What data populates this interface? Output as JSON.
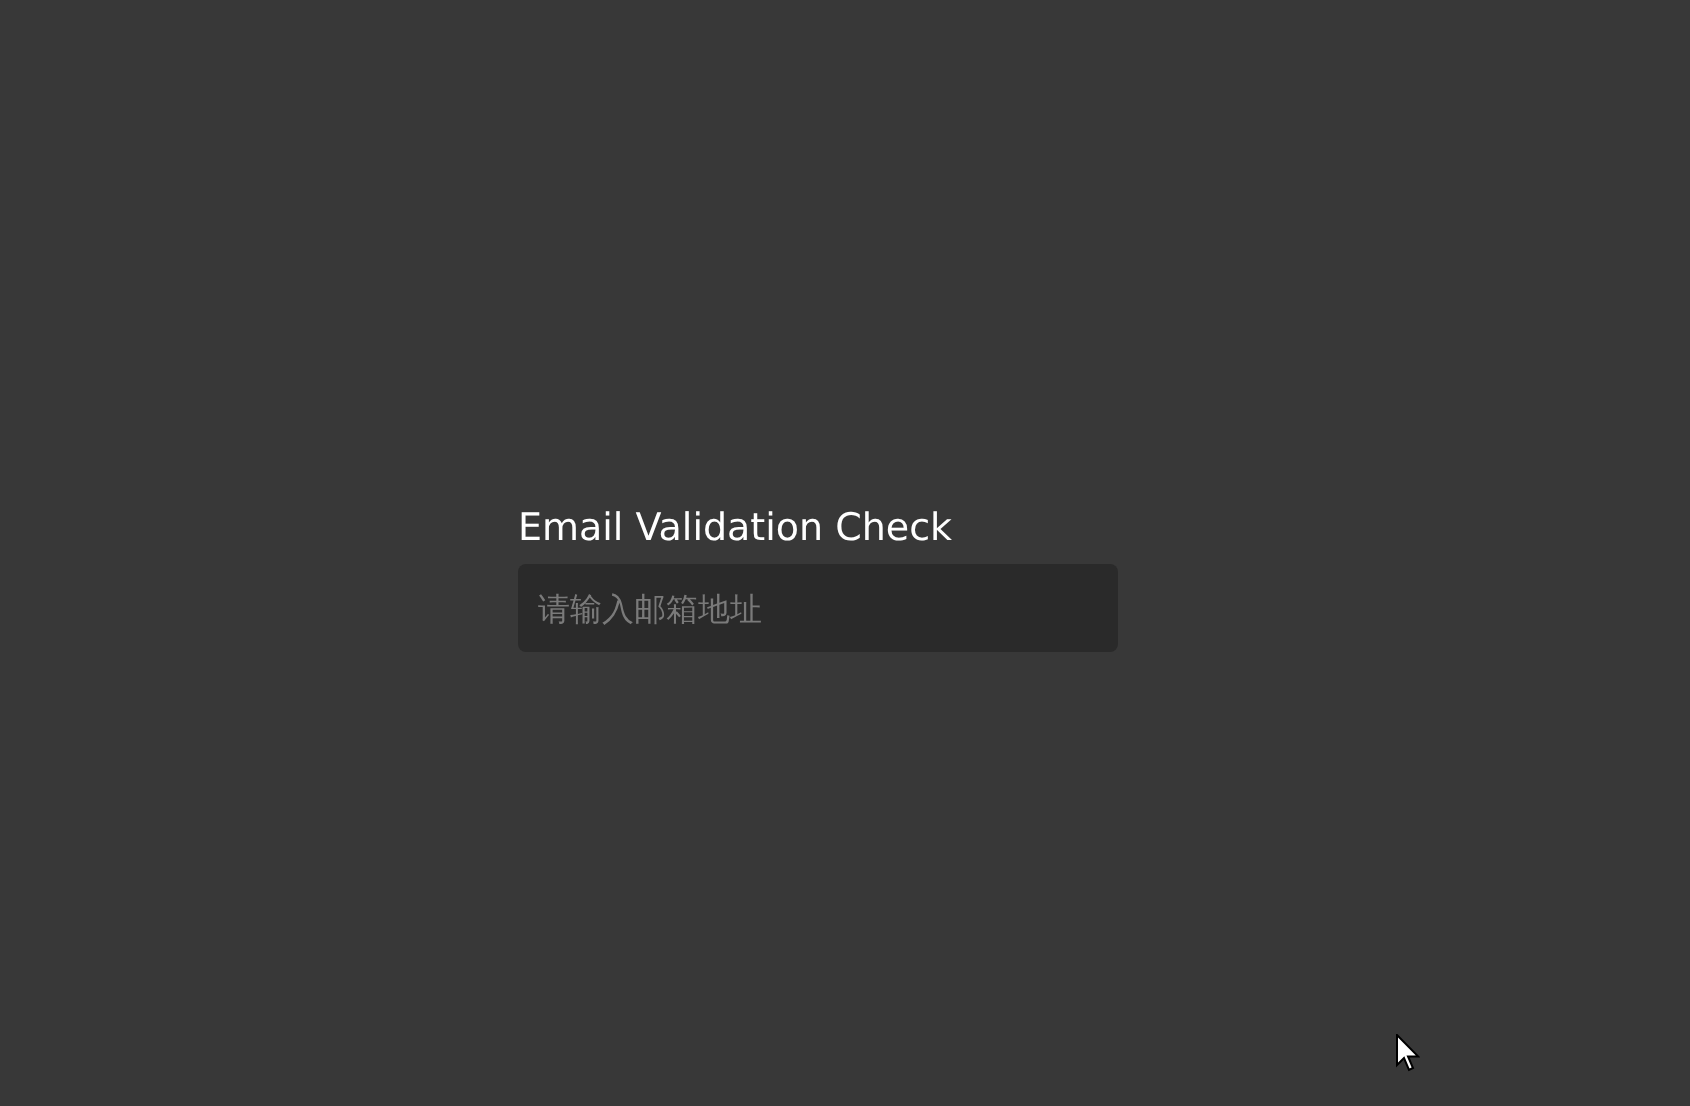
{
  "title": "Email Validation Check",
  "email_field": {
    "placeholder": "请输入邮箱地址"
  }
}
